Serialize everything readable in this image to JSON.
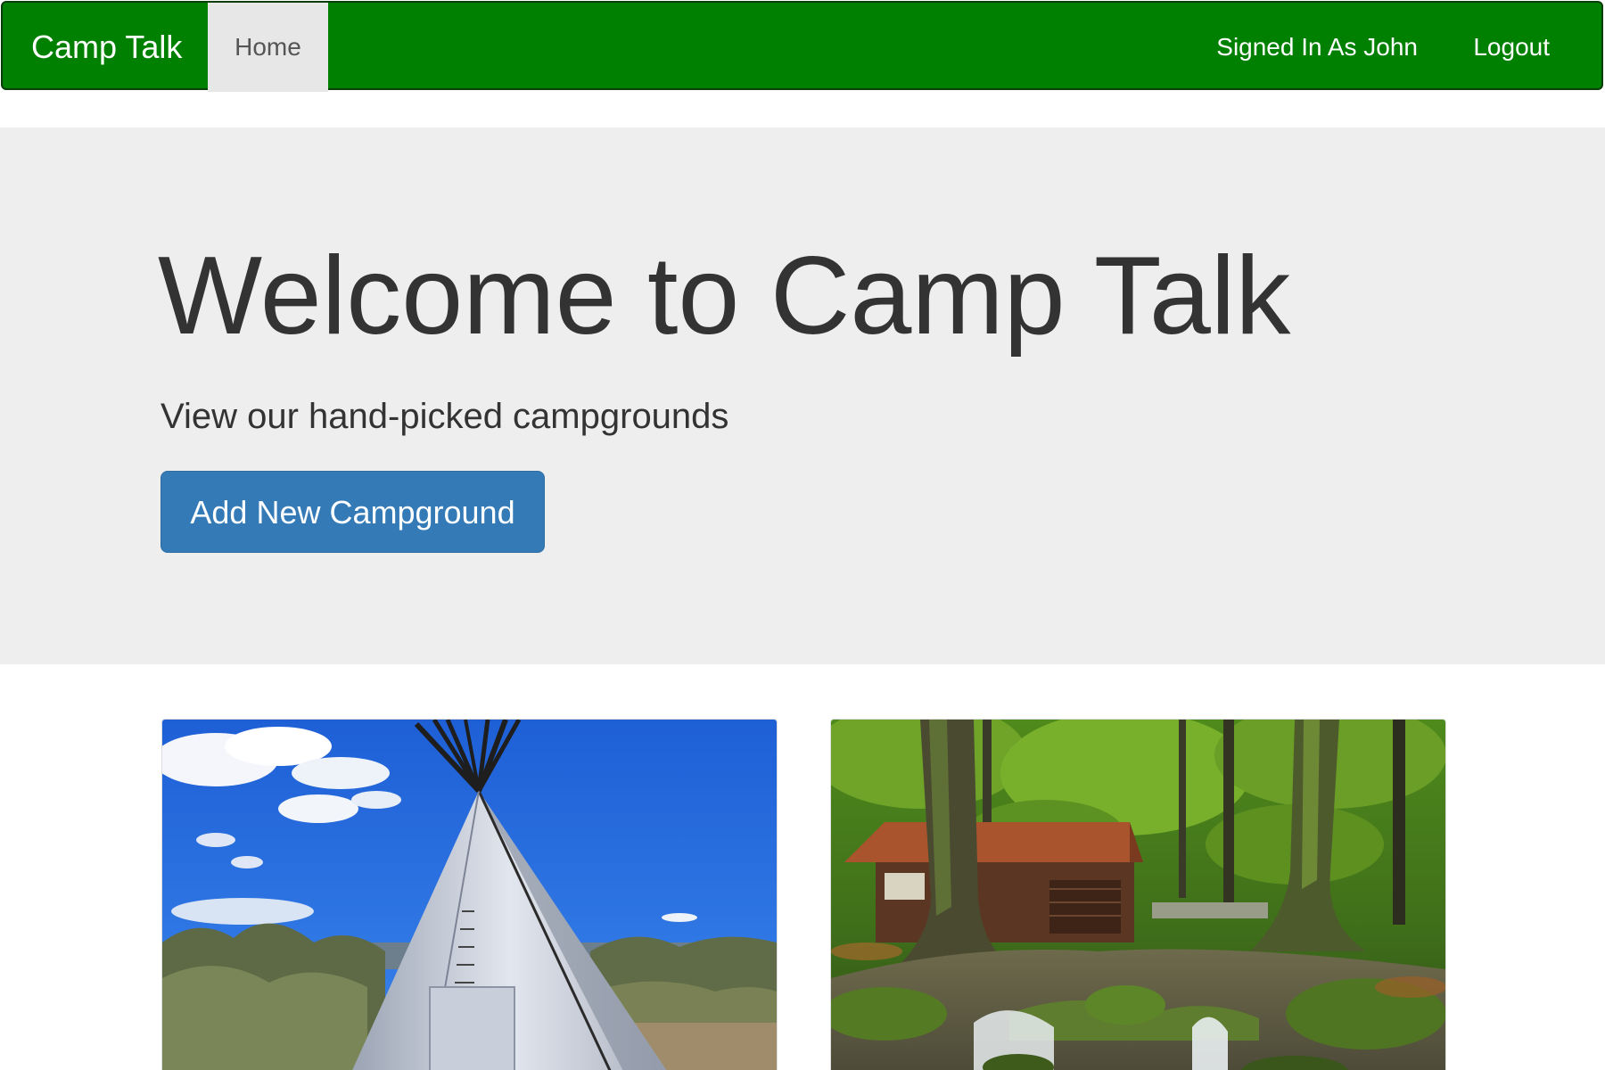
{
  "navbar": {
    "brand": "Camp Talk",
    "home_label": "Home",
    "user_label": "Signed In As John",
    "logout_label": "Logout",
    "background_color": "#008000"
  },
  "jumbotron": {
    "title": "Welcome to Camp Talk",
    "subtitle": "View our hand-picked campgrounds",
    "add_button_label": "Add New Campground",
    "button_color": "#337ab7"
  },
  "campgrounds": [
    {
      "image": "teepee-under-blue-sky"
    },
    {
      "image": "forest-cabin-by-stream"
    }
  ]
}
